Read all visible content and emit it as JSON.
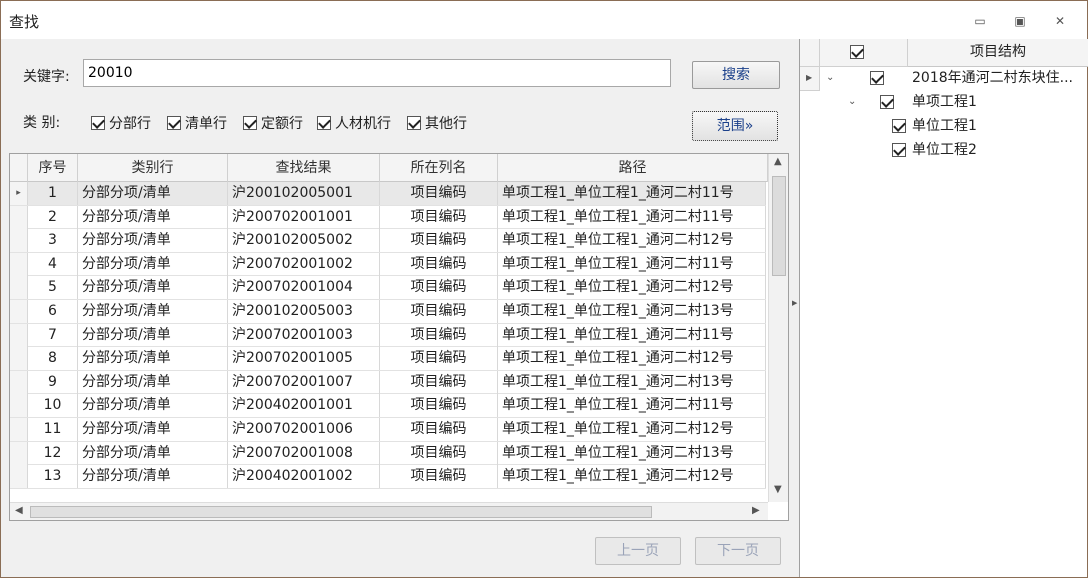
{
  "window": {
    "title": "查找",
    "min_icon": "minimize-icon",
    "restore_icon": "restore-icon",
    "close_icon": "close-icon"
  },
  "search": {
    "keyword_label": "关键字:",
    "keyword_value": "20010",
    "search_button": "搜索",
    "category_label": "类  别:",
    "scope_button": "范围»",
    "categories": [
      {
        "label": "分部行",
        "checked": true
      },
      {
        "label": "清单行",
        "checked": true
      },
      {
        "label": "定额行",
        "checked": true
      },
      {
        "label": "人材机行",
        "checked": true
      },
      {
        "label": "其他行",
        "checked": true
      }
    ]
  },
  "grid": {
    "columns": [
      "序号",
      "类别行",
      "查找结果",
      "所在列名",
      "路径"
    ],
    "rows": [
      [
        "1",
        "分部分项/清单",
        "沪200102005001",
        "项目编码",
        "单项工程1_单位工程1_通河二村11号"
      ],
      [
        "2",
        "分部分项/清单",
        "沪200702001001",
        "项目编码",
        "单项工程1_单位工程1_通河二村11号"
      ],
      [
        "3",
        "分部分项/清单",
        "沪200102005002",
        "项目编码",
        "单项工程1_单位工程1_通河二村12号"
      ],
      [
        "4",
        "分部分项/清单",
        "沪200702001002",
        "项目编码",
        "单项工程1_单位工程1_通河二村11号"
      ],
      [
        "5",
        "分部分项/清单",
        "沪200702001004",
        "项目编码",
        "单项工程1_单位工程1_通河二村12号"
      ],
      [
        "6",
        "分部分项/清单",
        "沪200102005003",
        "项目编码",
        "单项工程1_单位工程1_通河二村13号"
      ],
      [
        "7",
        "分部分项/清单",
        "沪200702001003",
        "项目编码",
        "单项工程1_单位工程1_通河二村11号"
      ],
      [
        "8",
        "分部分项/清单",
        "沪200702001005",
        "项目编码",
        "单项工程1_单位工程1_通河二村12号"
      ],
      [
        "9",
        "分部分项/清单",
        "沪200702001007",
        "项目编码",
        "单项工程1_单位工程1_通河二村13号"
      ],
      [
        "10",
        "分部分项/清单",
        "沪200402001001",
        "项目编码",
        "单项工程1_单位工程1_通河二村11号"
      ],
      [
        "11",
        "分部分项/清单",
        "沪200702001006",
        "项目编码",
        "单项工程1_单位工程1_通河二村12号"
      ],
      [
        "12",
        "分部分项/清单",
        "沪200702001008",
        "项目编码",
        "单项工程1_单位工程1_通河二村13号"
      ],
      [
        "13",
        "分部分项/清单",
        "沪200402001002",
        "项目编码",
        "单项工程1_单位工程1_通河二村12号"
      ]
    ],
    "selected_row": 0
  },
  "pager": {
    "prev": "上一页",
    "next": "下一页"
  },
  "tree": {
    "header": "项目结构",
    "nodes": [
      {
        "label": "2018年通河二村东块住...",
        "checked": true
      },
      {
        "label": "单项工程1",
        "checked": true
      },
      {
        "label": "单位工程1",
        "checked": true
      },
      {
        "label": "单位工程2",
        "checked": true
      }
    ]
  }
}
